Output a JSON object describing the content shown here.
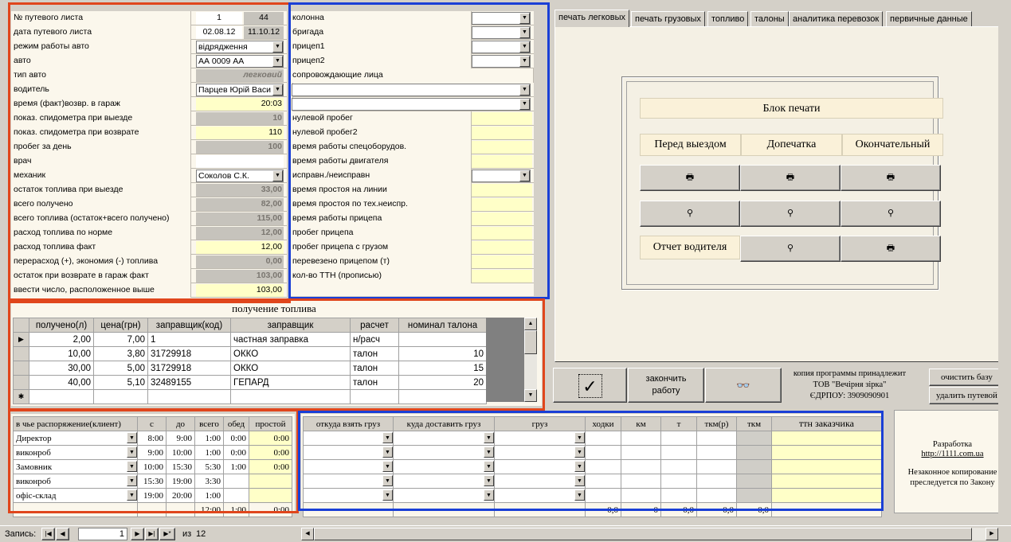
{
  "left_form": {
    "rows": [
      {
        "label": "№ путевого листа",
        "v1": "1",
        "v2": "44"
      },
      {
        "label": "дата путевого листа",
        "v1": "02.08.12",
        "v2": "11.10.12"
      },
      {
        "label": "режим работы авто",
        "value": "відрядження"
      },
      {
        "label": "авто",
        "value": "АА 0009 АА"
      },
      {
        "label": "тип авто",
        "value": "легковий"
      },
      {
        "label": "водитель",
        "value": "Парцев Юрій Васи"
      },
      {
        "label": "время (факт)возвр. в гараж",
        "value": "20:03"
      },
      {
        "label": "показ. спидометра при выезде",
        "value": "10"
      },
      {
        "label": "показ. спидометра при возврате",
        "value": "110"
      },
      {
        "label": "пробег за день",
        "value": "100"
      },
      {
        "label": "врач",
        "value": ""
      },
      {
        "label": "механик",
        "value": "Соколов С.К."
      },
      {
        "label": "остаток топлива при выезде",
        "value": "33,00"
      },
      {
        "label": "всего получено",
        "value": "82,00"
      },
      {
        "label": "всего топлива (остаток+всего получено)",
        "value": "115,00"
      },
      {
        "label": "расход топлива по норме",
        "value": "12,00"
      },
      {
        "label": "расход топлива факт",
        "value": "12,00"
      },
      {
        "label": "перерасход (+), экономия (-) топлива",
        "value": "0,00"
      },
      {
        "label": "остаток при возврате в гараж  факт",
        "value": "103,00"
      },
      {
        "label": "ввести число, расположенное выше",
        "value": "103,00"
      }
    ]
  },
  "mid_form": {
    "rows": [
      "колонна",
      "бригада",
      "прицеп1",
      "прицеп2",
      "сопровождающие лица",
      "",
      "",
      "нулевой пробег",
      "нулевой пробег2",
      "время работы спецоборудов.",
      "время работы двигателя",
      "исправн./неисправн",
      "время простоя на линии",
      "время простоя по тех.неиспр.",
      "время работы прицепа",
      "пробег прицепа",
      "пробег прицепа с грузом",
      "перевезено прицепом (т)",
      "кол-во ТТН (прописью)"
    ]
  },
  "tabs": [
    "печать легковых",
    "печать грузовых",
    "топливо",
    "талоны",
    "аналитика перевозок",
    "первичные данные"
  ],
  "print_block": {
    "title": "Блок печати",
    "col1": "Перед выездом",
    "col2": "Допечатка",
    "col3": "Окончательный",
    "driver_report": "Отчет водителя"
  },
  "fuel": {
    "title": "получение топлива",
    "headers": [
      "получено(л)",
      "цена(грн)",
      "заправщик(код)",
      "заправщик",
      "расчет",
      "номинал талона"
    ],
    "rows": [
      [
        "2,00",
        "7,00",
        "1",
        "частная заправка",
        "н/расч",
        ""
      ],
      [
        "10,00",
        "3,80",
        "31729918",
        "ОККО",
        "талон",
        "10"
      ],
      [
        "30,00",
        "5,00",
        "31729918",
        "ОККО",
        "талон",
        "15"
      ],
      [
        "40,00",
        "5,10",
        "32489155",
        "ГЕПАРД",
        "талон",
        "20"
      ]
    ]
  },
  "actions": {
    "finish": "закончить работу",
    "owner_line1": "копия программы принадлежит",
    "owner_line2": "ТОВ \"Вечірня зірка\"",
    "owner_line3": "ЄДРПОУ: 3909090901",
    "clear_db": "очистить базу",
    "delete_sheet": "удалить путевой"
  },
  "schedule": {
    "headers": [
      "в чье распоряжение(клиент)",
      "с",
      "до",
      "всего",
      "обед",
      "простой"
    ],
    "rows": [
      [
        "Директор",
        "8:00",
        "9:00",
        "1:00",
        "0:00",
        "0:00"
      ],
      [
        "виконроб",
        "9:00",
        "10:00",
        "1:00",
        "0:00",
        "0:00"
      ],
      [
        "Замовник",
        "10:00",
        "15:30",
        "5:30",
        "1:00",
        "0:00"
      ],
      [
        "виконроб",
        "15:30",
        "19:00",
        "3:30",
        "",
        ""
      ],
      [
        "офіс-склад",
        "19:00",
        "20:00",
        "1:00",
        "",
        ""
      ]
    ],
    "totals": [
      "",
      "",
      "",
      "12:00",
      "1:00",
      "0:00"
    ]
  },
  "cargo": {
    "headers": [
      "откуда взять груз",
      "куда доставить груз",
      "груз",
      "ходки",
      "км",
      "т",
      "ткм(р)",
      "ткм",
      "ттн заказчика"
    ],
    "totals": [
      "",
      "",
      "",
      "0,0",
      "0",
      "0,0",
      "0,0",
      "0,0",
      ""
    ]
  },
  "dev": {
    "line1": "Разработка",
    "link": "http://1111.com.ua",
    "line2": "Незаконное копирование",
    "line3": "преследуется по Закону"
  },
  "status": {
    "record_label": "Запись:",
    "record": "1",
    "of": "из",
    "total": "12"
  }
}
